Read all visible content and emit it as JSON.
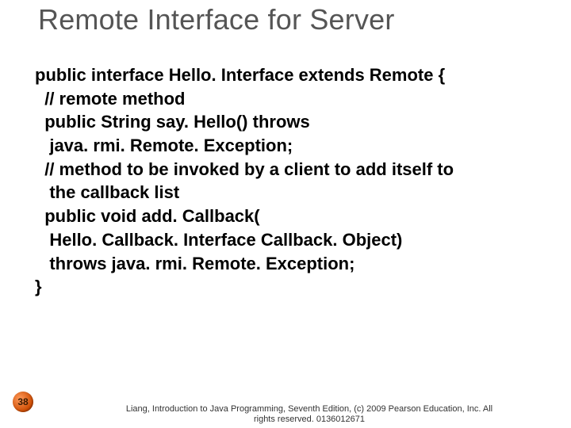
{
  "title": "Remote Interface for Server",
  "code": {
    "l0": "public interface Hello. Interface extends Remote {",
    "l1": "  // remote method",
    "l2": "  public String say. Hello() throws",
    "l3": "   java. rmi. Remote. Exception;",
    "l4": "  // method to be invoked by a client to add itself to",
    "l5": "   the callback list",
    "l6": "  public void add. Callback(",
    "l7": "   Hello. Callback. Interface Callback. Object)",
    "l8": "   throws java. rmi. Remote. Exception;",
    "l9": "}"
  },
  "pageNumber": "38",
  "footer": {
    "line1": "Liang, Introduction to Java Programming, Seventh Edition, (c) 2009 Pearson Education, Inc. All",
    "line2": "rights reserved. 0136012671"
  }
}
